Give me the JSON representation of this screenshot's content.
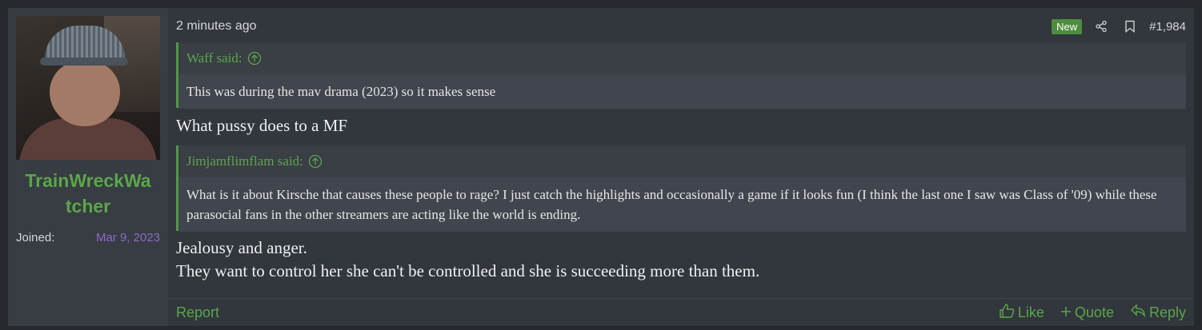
{
  "user": {
    "name": "TrainWreckWatcher",
    "joined_label": "Joined:",
    "joined_date": "Mar 9, 2023"
  },
  "post": {
    "timestamp": "2 minutes ago",
    "badge": "New",
    "number": "#1,984",
    "quote1": {
      "author": "Waff said:",
      "text": "This was during the mav drama (2023) so it makes sense"
    },
    "text1": "What pussy does to a MF",
    "quote2": {
      "author": "Jimjamflimflam said:",
      "text": "What is it about Kirsche that causes these people to rage? I just catch the highlights and occasionally a game if it looks fun (I think the last one I saw was Class of '09) while these parasocial fans in the other streamers are acting like the world is ending."
    },
    "text2_line1": "Jealousy and anger.",
    "text2_line2": "They want to control her she can't be controlled and she is succeeding more than them."
  },
  "footer": {
    "report": "Report",
    "like": "Like",
    "quote": "Quote",
    "reply": "Reply"
  },
  "icons": [
    "share-icon",
    "bookmark-icon",
    "up-arrow-circle-icon",
    "thumbs-up-icon",
    "plus-icon",
    "reply-icon"
  ],
  "colors": {
    "accent_green": "#5aa64a",
    "badge_green": "#4e8d3f",
    "joined_purple": "#8c6ac9",
    "background": "#32363d"
  }
}
